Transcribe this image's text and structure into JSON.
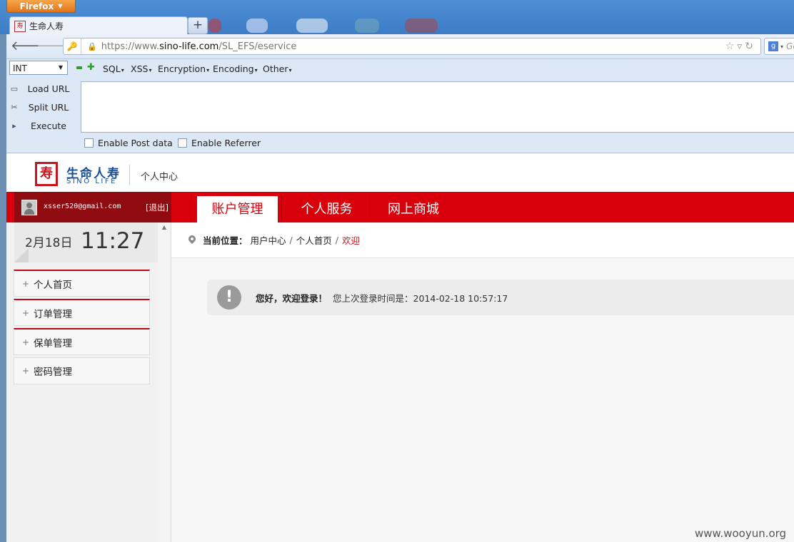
{
  "browser": {
    "app_button": "Firefox",
    "tab_title": "生命人寿",
    "new_tab_symbol": "+",
    "url_prefix": "https://www.",
    "url_domain": "sino-life.com",
    "url_path": "/SL_EFS/eservice",
    "search_placeholder": "Go"
  },
  "hackbar": {
    "type_select": "INT",
    "menus": [
      "SQL",
      "XSS",
      "Encryption",
      "Encoding",
      "Other"
    ],
    "actions": [
      {
        "label": "Load URL",
        "icon": "load-url-icon"
      },
      {
        "label": "Split URL",
        "icon": "scissors-icon"
      },
      {
        "label": "Execute",
        "icon": "play-icon"
      }
    ],
    "checkboxes": [
      "Enable Post data",
      "Enable Referrer"
    ],
    "colors": {
      "minus": "#2aa02a",
      "plus": "#2aa02a"
    }
  },
  "site": {
    "logo_cn": "生命人寿",
    "logo_en": "SINO LIFE",
    "subtitle": "个人中心",
    "user_email": "xsser520@gmail.com",
    "logout": "[退出]",
    "main_tabs": [
      "账户管理",
      "个人服务",
      "网上商城"
    ],
    "active_tab": "账户管理",
    "brand_color": "#d8000b"
  },
  "sidebar": {
    "date": "2月18日",
    "time": "11:27",
    "items": [
      "个人首页",
      "订单管理",
      "保单管理",
      "密码管理"
    ]
  },
  "breadcrumb": {
    "label": "当前位置：",
    "trail": [
      "用户中心",
      "个人首页"
    ],
    "current": "欢迎"
  },
  "welcome": {
    "greeting": "您好，欢迎登录！",
    "message": "您上次登录时间是：2014-02-18 10:57:17"
  },
  "watermark": "www.wooyun.org"
}
